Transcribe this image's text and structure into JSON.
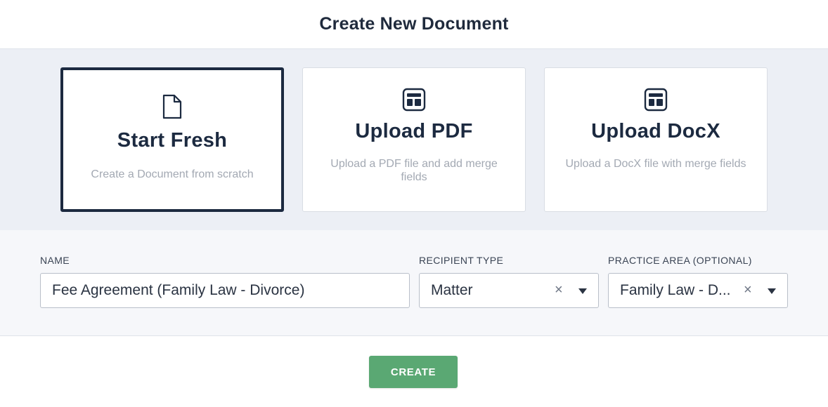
{
  "dialog": {
    "title": "Create New Document"
  },
  "options": [
    {
      "icon": "document-icon",
      "title": "Start Fresh",
      "description": "Create a Document from scratch",
      "selected": true
    },
    {
      "icon": "template-icon",
      "title": "Upload PDF",
      "description": "Upload a PDF file and add merge fields",
      "selected": false
    },
    {
      "icon": "template-icon",
      "title": "Upload DocX",
      "description": "Upload a DocX file with merge fields",
      "selected": false
    }
  ],
  "form": {
    "name": {
      "label": "NAME",
      "value": "Fee Agreement (Family Law - Divorce)"
    },
    "recipient_type": {
      "label": "RECIPIENT TYPE",
      "value": "Matter",
      "clear_glyph": "×"
    },
    "practice_area": {
      "label": "PRACTICE AREA (OPTIONAL)",
      "value": "Family Law - D...",
      "clear_glyph": "×"
    }
  },
  "footer": {
    "create_label": "CREATE"
  },
  "colors": {
    "accent_dark": "#1c2a40",
    "create_button": "#5aa873",
    "band_background": "#eceff5",
    "form_background": "#f6f7fa"
  }
}
